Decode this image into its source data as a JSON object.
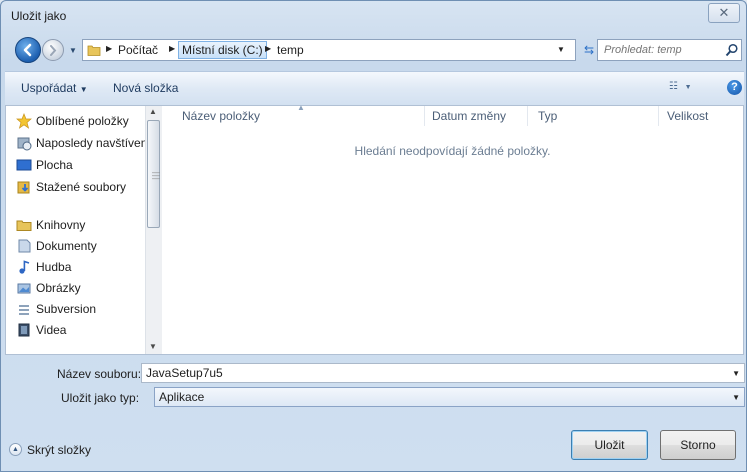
{
  "window": {
    "title": "Uložit jako",
    "close_glyph": "✕"
  },
  "address": {
    "crumbs": [
      "Počítač",
      "Místní disk (C:)",
      "temp"
    ],
    "active_crumb_index": 1
  },
  "search": {
    "placeholder": "Prohledat: temp"
  },
  "toolbar": {
    "organize_label": "Uspořádat",
    "new_folder_label": "Nová složka",
    "help_label": "?"
  },
  "nav": {
    "items": [
      {
        "label": "Oblíbené položky",
        "icon": "star-icon"
      },
      {
        "label": "Naposledy navštívené",
        "icon": "recent-places-icon"
      },
      {
        "label": "Plocha",
        "icon": "desktop-icon"
      },
      {
        "label": "Stažené soubory",
        "icon": "downloads-icon"
      },
      {
        "label": "Knihovny",
        "icon": "libraries-icon"
      },
      {
        "label": "Dokumenty",
        "icon": "documents-icon"
      },
      {
        "label": "Hudba",
        "icon": "music-icon"
      },
      {
        "label": "Obrázky",
        "icon": "pictures-icon"
      },
      {
        "label": "Subversion",
        "icon": "subversion-icon"
      },
      {
        "label": "Videa",
        "icon": "videos-icon"
      }
    ]
  },
  "columns": [
    "Název položky",
    "Datum změny",
    "Typ",
    "Velikost"
  ],
  "empty_message": "Hledání neodpovídají žádné položky.",
  "form": {
    "filename_label": "Název souboru:",
    "filename_value": "JavaSetup7u5",
    "filetype_label": "Uložit jako typ:",
    "filetype_value": "Aplikace"
  },
  "footer": {
    "hide_folders_label": "Skrýt složky",
    "save_label": "Uložit",
    "cancel_label": "Storno"
  },
  "colors": {
    "accent": "#2b70c7",
    "toolbar_text": "#1e3a5f",
    "column_header_text": "#4b5e77"
  }
}
